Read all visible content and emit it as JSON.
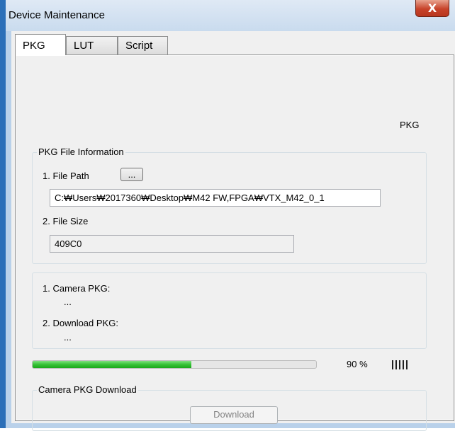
{
  "window": {
    "title": "Device Maintenance",
    "close_symbol": "X"
  },
  "tabs": [
    {
      "label": "PKG",
      "active": true
    },
    {
      "label": "LUT",
      "active": false
    },
    {
      "label": "Script",
      "active": false
    }
  ],
  "header_label": "PKG",
  "file_info": {
    "group_title": "PKG File Information",
    "file_path_label": "1. File Path",
    "browse_label": "...",
    "file_path_value": "C:₩Users₩2017360₩Desktop₩M42 FW,FPGA₩VTX_M42_0_1",
    "file_size_label": "2. File Size",
    "file_size_value": "409C0"
  },
  "pkg_info": {
    "camera_pkg_label": "1. Camera PKG:",
    "camera_pkg_value": "...",
    "download_pkg_label": "2. Download PKG:",
    "download_pkg_value": "..."
  },
  "progress": {
    "percent": 56,
    "percent_text": "90 %",
    "indicator_ticks": 5
  },
  "download": {
    "group_title": "Camera PKG Download",
    "button_label": "Download",
    "enabled": false
  },
  "colors": {
    "window_frame": "#b9d1ea",
    "progress_green": "#36c236",
    "close_red": "#c7432a"
  }
}
